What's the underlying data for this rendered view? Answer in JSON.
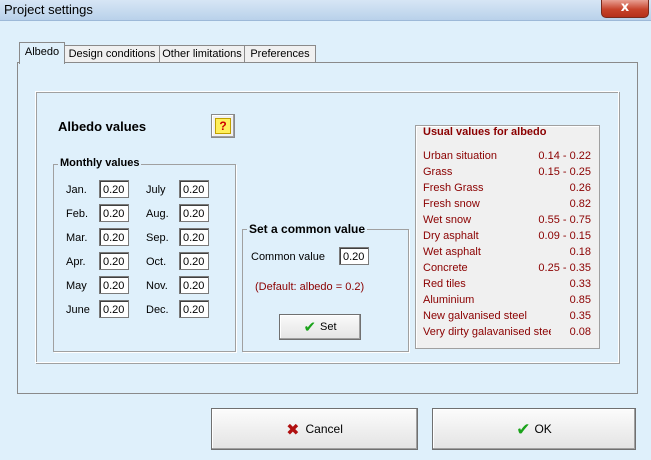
{
  "window": {
    "title": "Project settings",
    "close_glyph": "x"
  },
  "tabs": [
    {
      "label": "Albedo",
      "active": true
    },
    {
      "label": "Design conditions",
      "active": false
    },
    {
      "label": "Other limitations",
      "active": false
    },
    {
      "label": "Preferences",
      "active": false
    }
  ],
  "albedo": {
    "heading": "Albedo values",
    "help_glyph": "?",
    "monthly_group": "Monthly values",
    "months": [
      {
        "label": "Jan.",
        "value": "0.20"
      },
      {
        "label": "Feb.",
        "value": "0.20"
      },
      {
        "label": "Mar.",
        "value": "0.20"
      },
      {
        "label": "Apr.",
        "value": "0.20"
      },
      {
        "label": "May",
        "value": "0.20"
      },
      {
        "label": "June",
        "value": "0.20"
      },
      {
        "label": "July",
        "value": "0.20"
      },
      {
        "label": "Aug.",
        "value": "0.20"
      },
      {
        "label": "Sep.",
        "value": "0.20"
      },
      {
        "label": "Oct.",
        "value": "0.20"
      },
      {
        "label": "Nov.",
        "value": "0.20"
      },
      {
        "label": "Dec.",
        "value": "0.20"
      }
    ],
    "common": {
      "group": "Set a common value",
      "label": "Common value",
      "value": "0.20",
      "default_note": "(Default: albedo = 0.2)",
      "set_label": "Set"
    },
    "usual": {
      "title": "Usual values for albedo",
      "rows": [
        {
          "name": "Urban situation",
          "value": "0.14 - 0.22"
        },
        {
          "name": "Grass",
          "value": "0.15 - 0.25"
        },
        {
          "name": "Fresh Grass",
          "value": "0.26"
        },
        {
          "name": "Fresh snow",
          "value": "0.82"
        },
        {
          "name": "Wet snow",
          "value": "0.55 - 0.75"
        },
        {
          "name": "Dry asphalt",
          "value": "0.09 - 0.15"
        },
        {
          "name": "Wet asphalt",
          "value": "0.18"
        },
        {
          "name": "Concrete",
          "value": "0.25 - 0.35"
        },
        {
          "name": "Red tiles",
          "value": "0.33"
        },
        {
          "name": "Aluminium",
          "value": "0.85"
        },
        {
          "name": "New galvanised steel",
          "value": "0.35"
        },
        {
          "name": "Very dirty galavanised stee",
          "value": "0.08"
        }
      ]
    }
  },
  "buttons": {
    "cancel": "Cancel",
    "ok": "OK"
  },
  "colors": {
    "background": "#dff0fb",
    "usual_text": "#8b0000",
    "check": "#1aa31a",
    "cross": "#b01010"
  }
}
